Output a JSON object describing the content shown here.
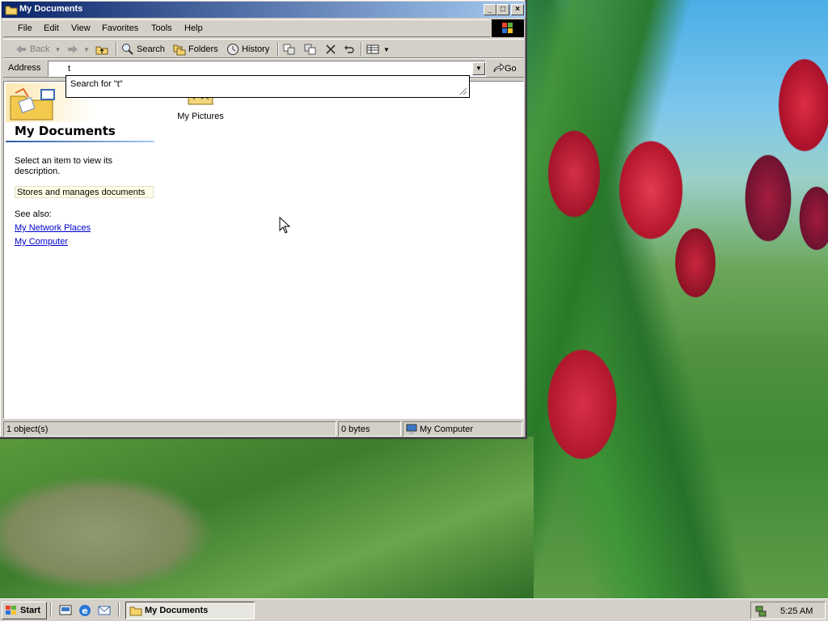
{
  "window": {
    "title": "My Documents",
    "controls": {
      "minimize": "_",
      "maximize": "□",
      "close": "×"
    }
  },
  "menu": [
    "File",
    "Edit",
    "View",
    "Favorites",
    "Tools",
    "Help"
  ],
  "toolbar": {
    "back": "Back",
    "search": "Search",
    "folders": "Folders",
    "history": "History"
  },
  "address": {
    "label": "Address",
    "value": "t",
    "go": "Go",
    "autocomplete": "Search for \"t\""
  },
  "webview": {
    "title": "My Documents",
    "description": "Select an item to view its description.",
    "info": "Stores and manages documents",
    "see_also": "See also:",
    "links": [
      "My Network Places",
      "My Computer"
    ]
  },
  "items": [
    {
      "label": "My Pictures",
      "icon": "pictures-folder-icon"
    }
  ],
  "status": {
    "objects": "1 object(s)",
    "size": "0 bytes",
    "zone": "My Computer"
  },
  "taskbar": {
    "start": "Start",
    "task": "My Documents",
    "clock": "5:25 AM"
  }
}
